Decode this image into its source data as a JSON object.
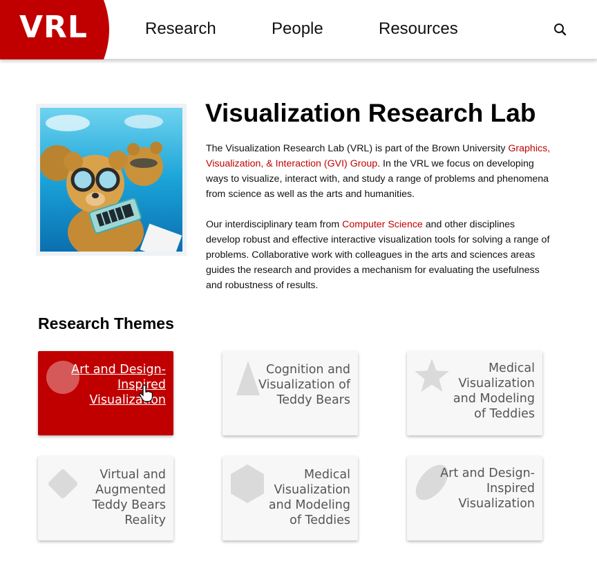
{
  "header": {
    "logo_text": "VRL",
    "brand_color": "#c00000",
    "nav": [
      {
        "label": "Research"
      },
      {
        "label": "People"
      },
      {
        "label": "Resources"
      }
    ],
    "search_icon": "search-icon"
  },
  "hero": {
    "image": "teddy-bears-underwater-photo",
    "title": "Visualization Research Lab",
    "para1_before": "The Visualization Research Lab (VRL) is part of the Brown University ",
    "para1_link": "Graphics, Visualization, & Interaction (GVI) Group",
    "para1_after": ". In the VRL we focus on developing ways to visualize, interact with, and study a range of problems and phenomena from science as well as the arts and humanities.",
    "para2_before": "Our interdisciplinary team from ",
    "para2_link": "Computer Science",
    "para2_after": " and other disciplines develop robust and effective interactive visualization tools for solving a range of problems. Collaborative work with colleagues in the arts and sciences areas guides the research and provides a mechanism for evaluating the usefulness and robustness of results."
  },
  "themes": {
    "title": "Research Themes",
    "cards": [
      {
        "lines": [
          "Art and Design-",
          "Inspired",
          "Visualization"
        ],
        "shape": "circle",
        "active": true
      },
      {
        "lines": [
          "Cognition and",
          "Visualization of",
          "Teddy Bears"
        ],
        "shape": "triangle",
        "active": false
      },
      {
        "lines": [
          "Medical",
          "Visualization",
          "and Modeling",
          "of Teddies"
        ],
        "shape": "star",
        "active": false
      },
      {
        "lines": [
          "Virtual and",
          "Augmented",
          "Teddy Bears",
          "Reality"
        ],
        "shape": "diamond",
        "active": false
      },
      {
        "lines": [
          "Medical",
          "Visualization",
          "and Modeling",
          "of Teddies"
        ],
        "shape": "hexagon",
        "active": false
      },
      {
        "lines": [
          "Art and Design-",
          "Inspired",
          "Visualization"
        ],
        "shape": "ellipse",
        "active": false
      }
    ]
  }
}
